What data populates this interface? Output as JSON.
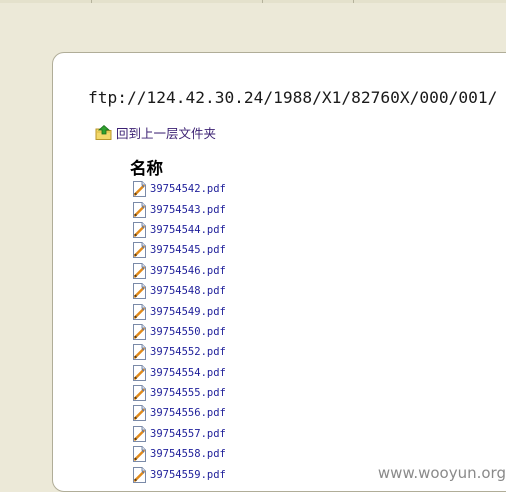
{
  "address": {
    "url": "ftp://124.42.30.24/1988/X1/82760X/000/001/"
  },
  "navigation": {
    "parent_folder_label": "回到上一层文件夹"
  },
  "listing": {
    "column_header": "名称",
    "files": [
      {
        "name": "39754542.pdf"
      },
      {
        "name": "39754543.pdf"
      },
      {
        "name": "39754544.pdf"
      },
      {
        "name": "39754545.pdf"
      },
      {
        "name": "39754546.pdf"
      },
      {
        "name": "39754548.pdf"
      },
      {
        "name": "39754549.pdf"
      },
      {
        "name": "39754550.pdf"
      },
      {
        "name": "39754552.pdf"
      },
      {
        "name": "39754554.pdf"
      },
      {
        "name": "39754555.pdf"
      },
      {
        "name": "39754556.pdf"
      },
      {
        "name": "39754557.pdf"
      },
      {
        "name": "39754558.pdf"
      },
      {
        "name": "39754559.pdf"
      }
    ]
  },
  "watermark": {
    "text": "www.wooyun.org"
  },
  "colors": {
    "window_background": "#ece9d8",
    "page_background": "#ffffff",
    "link_color": "#1f1f9a",
    "parent_link_color": "#3a1f72"
  },
  "icons": {
    "parent_folder": "folder-up-icon",
    "file": "pdf-file-icon"
  }
}
